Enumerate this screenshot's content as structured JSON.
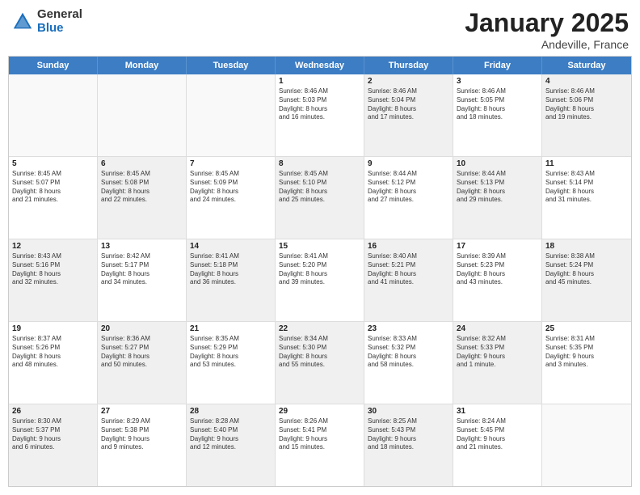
{
  "header": {
    "logo_general": "General",
    "logo_blue": "Blue",
    "title": "January 2025",
    "location": "Andeville, France"
  },
  "weekdays": [
    "Sunday",
    "Monday",
    "Tuesday",
    "Wednesday",
    "Thursday",
    "Friday",
    "Saturday"
  ],
  "rows": [
    [
      {
        "day": "",
        "info": "",
        "shaded": false,
        "empty": true
      },
      {
        "day": "",
        "info": "",
        "shaded": false,
        "empty": true
      },
      {
        "day": "",
        "info": "",
        "shaded": false,
        "empty": true
      },
      {
        "day": "1",
        "info": "Sunrise: 8:46 AM\nSunset: 5:03 PM\nDaylight: 8 hours\nand 16 minutes.",
        "shaded": false,
        "empty": false
      },
      {
        "day": "2",
        "info": "Sunrise: 8:46 AM\nSunset: 5:04 PM\nDaylight: 8 hours\nand 17 minutes.",
        "shaded": true,
        "empty": false
      },
      {
        "day": "3",
        "info": "Sunrise: 8:46 AM\nSunset: 5:05 PM\nDaylight: 8 hours\nand 18 minutes.",
        "shaded": false,
        "empty": false
      },
      {
        "day": "4",
        "info": "Sunrise: 8:46 AM\nSunset: 5:06 PM\nDaylight: 8 hours\nand 19 minutes.",
        "shaded": true,
        "empty": false
      }
    ],
    [
      {
        "day": "5",
        "info": "Sunrise: 8:45 AM\nSunset: 5:07 PM\nDaylight: 8 hours\nand 21 minutes.",
        "shaded": false,
        "empty": false
      },
      {
        "day": "6",
        "info": "Sunrise: 8:45 AM\nSunset: 5:08 PM\nDaylight: 8 hours\nand 22 minutes.",
        "shaded": true,
        "empty": false
      },
      {
        "day": "7",
        "info": "Sunrise: 8:45 AM\nSunset: 5:09 PM\nDaylight: 8 hours\nand 24 minutes.",
        "shaded": false,
        "empty": false
      },
      {
        "day": "8",
        "info": "Sunrise: 8:45 AM\nSunset: 5:10 PM\nDaylight: 8 hours\nand 25 minutes.",
        "shaded": true,
        "empty": false
      },
      {
        "day": "9",
        "info": "Sunrise: 8:44 AM\nSunset: 5:12 PM\nDaylight: 8 hours\nand 27 minutes.",
        "shaded": false,
        "empty": false
      },
      {
        "day": "10",
        "info": "Sunrise: 8:44 AM\nSunset: 5:13 PM\nDaylight: 8 hours\nand 29 minutes.",
        "shaded": true,
        "empty": false
      },
      {
        "day": "11",
        "info": "Sunrise: 8:43 AM\nSunset: 5:14 PM\nDaylight: 8 hours\nand 31 minutes.",
        "shaded": false,
        "empty": false
      }
    ],
    [
      {
        "day": "12",
        "info": "Sunrise: 8:43 AM\nSunset: 5:16 PM\nDaylight: 8 hours\nand 32 minutes.",
        "shaded": true,
        "empty": false
      },
      {
        "day": "13",
        "info": "Sunrise: 8:42 AM\nSunset: 5:17 PM\nDaylight: 8 hours\nand 34 minutes.",
        "shaded": false,
        "empty": false
      },
      {
        "day": "14",
        "info": "Sunrise: 8:41 AM\nSunset: 5:18 PM\nDaylight: 8 hours\nand 36 minutes.",
        "shaded": true,
        "empty": false
      },
      {
        "day": "15",
        "info": "Sunrise: 8:41 AM\nSunset: 5:20 PM\nDaylight: 8 hours\nand 39 minutes.",
        "shaded": false,
        "empty": false
      },
      {
        "day": "16",
        "info": "Sunrise: 8:40 AM\nSunset: 5:21 PM\nDaylight: 8 hours\nand 41 minutes.",
        "shaded": true,
        "empty": false
      },
      {
        "day": "17",
        "info": "Sunrise: 8:39 AM\nSunset: 5:23 PM\nDaylight: 8 hours\nand 43 minutes.",
        "shaded": false,
        "empty": false
      },
      {
        "day": "18",
        "info": "Sunrise: 8:38 AM\nSunset: 5:24 PM\nDaylight: 8 hours\nand 45 minutes.",
        "shaded": true,
        "empty": false
      }
    ],
    [
      {
        "day": "19",
        "info": "Sunrise: 8:37 AM\nSunset: 5:26 PM\nDaylight: 8 hours\nand 48 minutes.",
        "shaded": false,
        "empty": false
      },
      {
        "day": "20",
        "info": "Sunrise: 8:36 AM\nSunset: 5:27 PM\nDaylight: 8 hours\nand 50 minutes.",
        "shaded": true,
        "empty": false
      },
      {
        "day": "21",
        "info": "Sunrise: 8:35 AM\nSunset: 5:29 PM\nDaylight: 8 hours\nand 53 minutes.",
        "shaded": false,
        "empty": false
      },
      {
        "day": "22",
        "info": "Sunrise: 8:34 AM\nSunset: 5:30 PM\nDaylight: 8 hours\nand 55 minutes.",
        "shaded": true,
        "empty": false
      },
      {
        "day": "23",
        "info": "Sunrise: 8:33 AM\nSunset: 5:32 PM\nDaylight: 8 hours\nand 58 minutes.",
        "shaded": false,
        "empty": false
      },
      {
        "day": "24",
        "info": "Sunrise: 8:32 AM\nSunset: 5:33 PM\nDaylight: 9 hours\nand 1 minute.",
        "shaded": true,
        "empty": false
      },
      {
        "day": "25",
        "info": "Sunrise: 8:31 AM\nSunset: 5:35 PM\nDaylight: 9 hours\nand 3 minutes.",
        "shaded": false,
        "empty": false
      }
    ],
    [
      {
        "day": "26",
        "info": "Sunrise: 8:30 AM\nSunset: 5:37 PM\nDaylight: 9 hours\nand 6 minutes.",
        "shaded": true,
        "empty": false
      },
      {
        "day": "27",
        "info": "Sunrise: 8:29 AM\nSunset: 5:38 PM\nDaylight: 9 hours\nand 9 minutes.",
        "shaded": false,
        "empty": false
      },
      {
        "day": "28",
        "info": "Sunrise: 8:28 AM\nSunset: 5:40 PM\nDaylight: 9 hours\nand 12 minutes.",
        "shaded": true,
        "empty": false
      },
      {
        "day": "29",
        "info": "Sunrise: 8:26 AM\nSunset: 5:41 PM\nDaylight: 9 hours\nand 15 minutes.",
        "shaded": false,
        "empty": false
      },
      {
        "day": "30",
        "info": "Sunrise: 8:25 AM\nSunset: 5:43 PM\nDaylight: 9 hours\nand 18 minutes.",
        "shaded": true,
        "empty": false
      },
      {
        "day": "31",
        "info": "Sunrise: 8:24 AM\nSunset: 5:45 PM\nDaylight: 9 hours\nand 21 minutes.",
        "shaded": false,
        "empty": false
      },
      {
        "day": "",
        "info": "",
        "shaded": false,
        "empty": true
      }
    ]
  ]
}
